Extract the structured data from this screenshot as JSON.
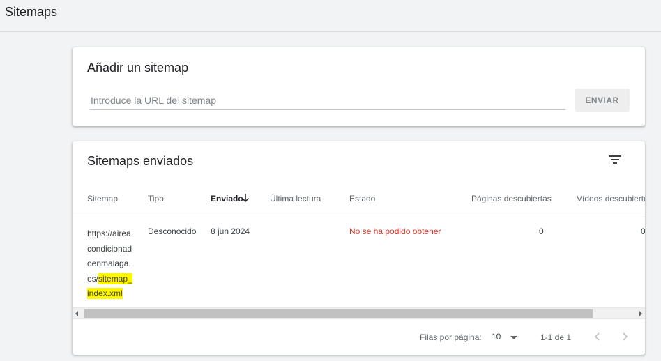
{
  "page": {
    "title": "Sitemaps"
  },
  "add_card": {
    "title": "Añadir un sitemap",
    "input_placeholder": "Introduce la URL del sitemap",
    "input_value": "",
    "submit_label": "ENVIAR"
  },
  "list_card": {
    "title": "Sitemaps enviados",
    "filter_icon": "filter-list-icon",
    "columns": {
      "sitemap": "Sitemap",
      "type": "Tipo",
      "submitted": "Enviado",
      "last_read": "Última lectura",
      "status": "Estado",
      "pages": "Páginas descubiertas",
      "videos": "Vídeos descubiertos"
    },
    "sort_icon": "arrow-downward-icon",
    "rows": [
      {
        "sitemap_plain": "https://airea\ncondicionad\noenmalaga.\nes/",
        "sitemap_highlight_1": "sitemap_",
        "sitemap_highlight_2": "index.xml",
        "type": "Desconocido",
        "submitted": "8 jun 2024",
        "last_read": "",
        "status": "No se ha podido obtener",
        "pages": "0",
        "videos": "0"
      }
    ],
    "footer": {
      "rows_per_page_label": "Filas por página:",
      "rows_per_page_value": "10",
      "range": "1-1 de 1"
    }
  },
  "colors": {
    "background": "#f1f3f4",
    "error": "#d93025",
    "highlight": "#fff700"
  }
}
